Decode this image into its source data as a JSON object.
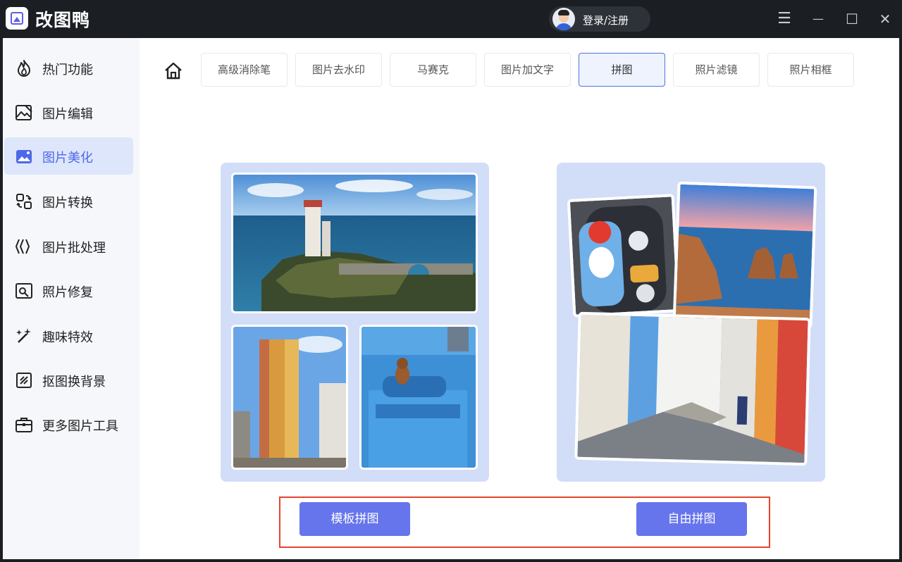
{
  "app": {
    "title": "改图鸭",
    "login_label": "登录/注册"
  },
  "window_controls": [
    {
      "name": "menu-icon",
      "glyph": "☰"
    },
    {
      "name": "minimize-icon",
      "glyph": "—"
    },
    {
      "name": "maximize-icon",
      "glyph": "☐"
    },
    {
      "name": "close-icon",
      "glyph": "✕"
    }
  ],
  "sidebar": {
    "items": [
      {
        "label": "热门功能",
        "icon": "flame-icon",
        "active": false
      },
      {
        "label": "图片编辑",
        "icon": "image-edit-icon",
        "active": false
      },
      {
        "label": "图片美化",
        "icon": "image-beautify-icon",
        "active": true
      },
      {
        "label": "图片转换",
        "icon": "convert-icon",
        "active": false
      },
      {
        "label": "图片批处理",
        "icon": "batch-icon",
        "active": false
      },
      {
        "label": "照片修复",
        "icon": "photo-repair-icon",
        "active": false
      },
      {
        "label": "趣味特效",
        "icon": "magic-wand-icon",
        "active": false
      },
      {
        "label": "抠图换背景",
        "icon": "cutout-icon",
        "active": false
      },
      {
        "label": "更多图片工具",
        "icon": "toolbox-icon",
        "active": false
      }
    ]
  },
  "tabs": [
    {
      "label": "高级消除笔",
      "active": false
    },
    {
      "label": "图片去水印",
      "active": false
    },
    {
      "label": "马赛克",
      "active": false
    },
    {
      "label": "图片加文字",
      "active": false
    },
    {
      "label": "拼图",
      "active": true
    },
    {
      "label": "照片滤镜",
      "active": false
    },
    {
      "label": "照片相框",
      "active": false
    }
  ],
  "actions": {
    "template_collage": "模板拼图",
    "free_collage": "自由拼图"
  },
  "colors": {
    "accent": "#6675eb",
    "active_tab_border": "#4e74e6",
    "sidebar_active_bg": "#dde6fb",
    "panel_bg": "#d2ddf7",
    "highlight_frame": "#e6442c"
  }
}
